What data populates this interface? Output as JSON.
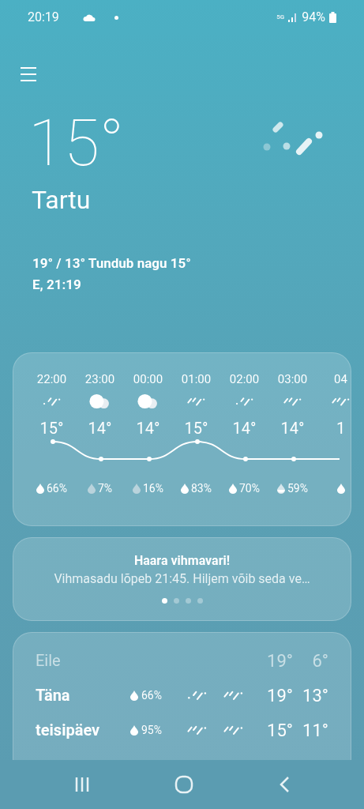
{
  "status_bar": {
    "time": "20:19",
    "battery": "94%",
    "network": "5G"
  },
  "current": {
    "temperature": "15°",
    "city": "Tartu",
    "high_low_feels": "19° / 13° Tundub nagu 15°",
    "updated": "E, 21:19"
  },
  "hourly": [
    {
      "time": "22:00",
      "weather": {
        "kind": "drizzle"
      },
      "temp": "15°",
      "drop": {
        "kind": "full"
      },
      "precip": "66%"
    },
    {
      "time": "23:00",
      "weather": {
        "kind": "cloudy"
      },
      "temp": "14°",
      "drop": {
        "kind": "light"
      },
      "precip": "7%"
    },
    {
      "time": "00:00",
      "weather": {
        "kind": "cloudy"
      },
      "temp": "14°",
      "drop": {
        "kind": "light"
      },
      "precip": "16%"
    },
    {
      "time": "01:00",
      "weather": {
        "kind": "rain"
      },
      "temp": "15°",
      "drop": {
        "kind": "full"
      },
      "precip": "83%"
    },
    {
      "time": "02:00",
      "weather": {
        "kind": "drizzle"
      },
      "temp": "14°",
      "drop": {
        "kind": "full"
      },
      "precip": "70%"
    },
    {
      "time": "03:00",
      "weather": {
        "kind": "rain"
      },
      "temp": "14°",
      "drop": {
        "kind": "half"
      },
      "precip": "59%"
    },
    {
      "time": "04",
      "weather": {
        "kind": "rain"
      },
      "temp": "1",
      "drop": {
        "kind": "full"
      }
    }
  ],
  "notice": {
    "title": "Haara vihmavari!",
    "text": "Vihmasadu lõpeb 21:45. Hiljem võib seda ve…",
    "pages": [
      {
        "selected": true
      },
      {
        "selected": false
      },
      {
        "selected": false
      },
      {
        "selected": false
      }
    ]
  },
  "daily": [
    {
      "day": "Eile",
      "muted": true,
      "high": "19°",
      "low": "6°"
    },
    {
      "day": "Täna",
      "muted": false,
      "precip": "66%",
      "day_weather": {
        "kind": "drizzle"
      },
      "night_weather": {
        "kind": "rain"
      },
      "high": "19°",
      "low": "13°"
    },
    {
      "day": "teisipäev",
      "muted": false,
      "precip": "95%",
      "day_weather": {
        "kind": "rain"
      },
      "night_weather": {
        "kind": "rain"
      },
      "high": "15°",
      "low": "11°"
    }
  ]
}
